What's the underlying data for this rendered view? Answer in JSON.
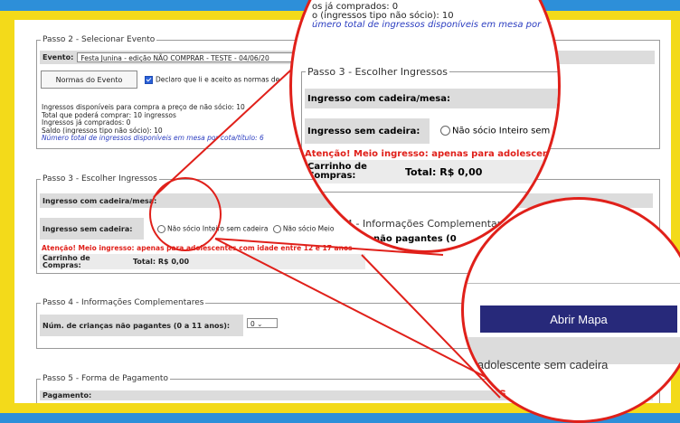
{
  "step2": {
    "legend": "Passo 2 - Selecionar Evento",
    "event_label": "Evento:",
    "event_value": "Festa Junina - edição NÃO COMPRAR - TESTE - 04/06/20",
    "rules_button": "Normas do Evento",
    "declaration": "Declaro que li e aceito as normas de",
    "info_lines": [
      "Ingressos disponíveis para compra a preço de não sócio: 10",
      "Total que poderá comprar: 10 ingressos",
      "Ingressos já comprados: 0",
      "Saldo (ingressos tipo não sócio): 10"
    ],
    "info_blue": "Número total de ingressos disponíveis em mesa por cota/título: 6"
  },
  "step3": {
    "legend": "Passo 3 - Escolher Ingressos",
    "with_chair_label": "Ingresso com cadeira/mesa:",
    "without_chair_label": "Ingresso sem cadeira:",
    "option_inteiro": "Não sócio Inteiro sem cadeira",
    "option_meio": "Não sócio Meio",
    "warning": "Atenção! Meio ingresso: apenas para adolescentes com idade entre 12 e 17 anos",
    "cart_label": "Carrinho de Compras:",
    "total": "Total: R$ 0,00"
  },
  "step4": {
    "legend": "Passo 4 - Informações Complementares",
    "children_label": "Núm. de crianças não pagantes (0 a 11 anos):",
    "children_value": "0"
  },
  "step5": {
    "legend": "Passo 5 - Forma de Pagamento",
    "payment_label": "Pagamento:"
  },
  "zoom_top": {
    "line1": "os já comprados: 0",
    "line2": "o (ingressos tipo não sócio): 10",
    "line3": "úmero total de ingressos disponíveis em mesa por",
    "legend": "Passo 3 - Escolher Ingressos",
    "with_chair": "Ingresso com cadeira/mesa:",
    "without_chair": "Ingresso sem cadeira:",
    "option": "Não sócio Inteiro sem ca",
    "warning": "Atenção! Meio ingresso: apenas para adolescentes c",
    "cart": "Carrinho de Compras:",
    "total": "Total: R$ 0,00",
    "below_legend": "4 - Informações Complementares",
    "below_text": "não pagantes (0"
  },
  "zoom_right": {
    "map_button": "Abrir Mapa",
    "text": "o adolescente sem cadeira",
    "red_text": "os"
  },
  "colors": {
    "blue_bg": "#2d8fd9",
    "yellow_frame": "#f3da1a",
    "highlight_red": "#e0201a",
    "map_button": "#27297a"
  }
}
